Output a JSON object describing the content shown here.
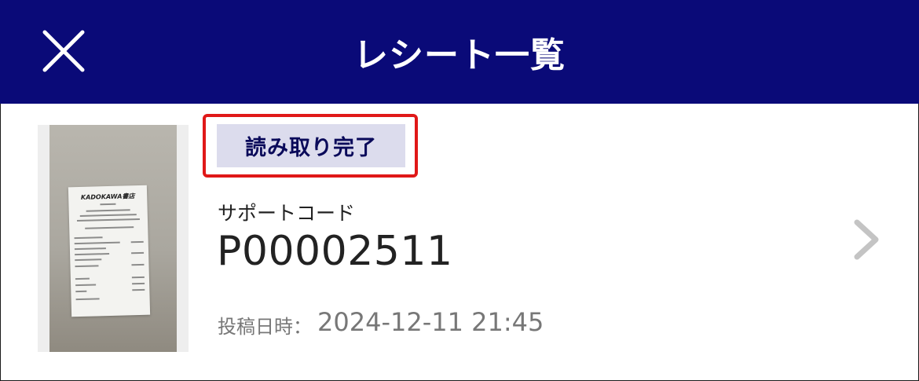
{
  "header": {
    "title": "レシート一覧",
    "close_icon": "close-icon",
    "background": "#0a0a78"
  },
  "receipt": {
    "thumbnail": {
      "store_name": "KADOKAWA書店"
    },
    "status": {
      "label": "読み取り完了",
      "highlight_color": "#e01818"
    },
    "support_code": {
      "label": "サポートコード",
      "value": "P00002511"
    },
    "posted": {
      "label": "投稿日時：",
      "value": "2024-12-11 21:45"
    },
    "chevron_icon": "chevron-right-icon"
  }
}
